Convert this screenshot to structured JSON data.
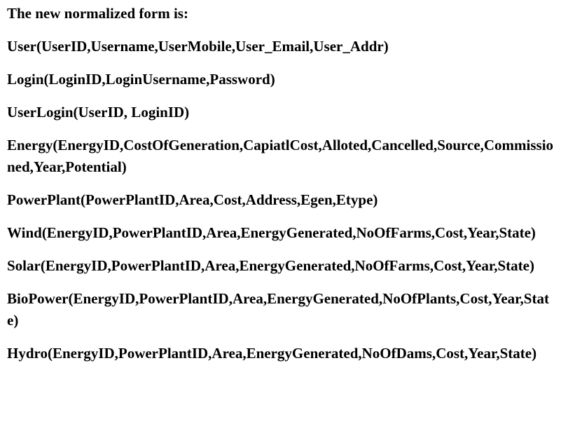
{
  "heading": "The new normalized form is:",
  "relations": [
    "User(UserID,Username,UserMobile,User_Email,User_Addr)",
    "Login(LoginID,LoginUsername,Password)",
    "UserLogin(UserID, LoginID)",
    "Energy(EnergyID,CostOfGeneration,CapiatlCost,Alloted,Cancelled,Source,Commissioned,Year,Potential)",
    "PowerPlant(PowerPlantID,Area,Cost,Address,Egen,Etype)",
    "Wind(EnergyID,PowerPlantID,Area,EnergyGenerated,NoOfFarms,Cost,Year,State)",
    "Solar(EnergyID,PowerPlantID,Area,EnergyGenerated,NoOfFarms,Cost,Year,State)",
    "BioPower(EnergyID,PowerPlantID,Area,EnergyGenerated,NoOfPlants,Cost,Year,State)",
    "Hydro(EnergyID,PowerPlantID,Area,EnergyGenerated,NoOfDams,Cost,Year,State)"
  ]
}
